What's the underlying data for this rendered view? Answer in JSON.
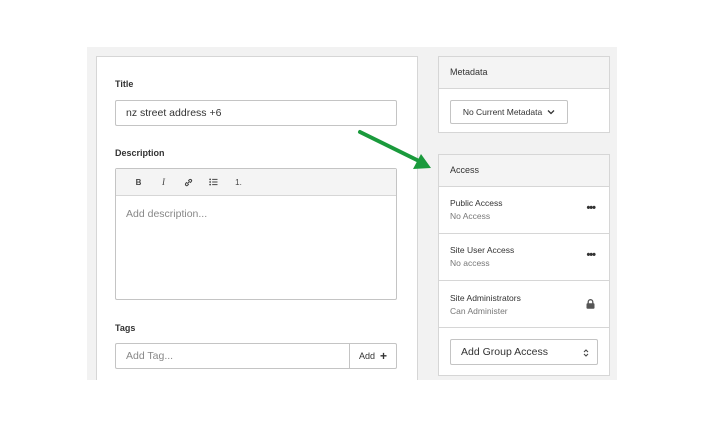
{
  "form": {
    "title_label": "Title",
    "title_value": "nz street address +6",
    "description_label": "Description",
    "toolbar": {
      "bold": "B",
      "italic": "I",
      "link": "🔗",
      "bullets": "☰",
      "numbered": "1."
    },
    "description_placeholder": "Add description...",
    "tags_label": "Tags",
    "tag_placeholder": "Add Tag...",
    "tag_add_label": "Add",
    "tag_add_icon": "+"
  },
  "metadata": {
    "header": "Metadata",
    "button_label": "No Current Metadata",
    "chevron": "⌄"
  },
  "access": {
    "header": "Access",
    "rows": [
      {
        "title": "Public Access",
        "value": "No Access",
        "icon": "more-dots-icon"
      },
      {
        "title": "Site User Access",
        "value": "No access",
        "icon": "more-dots-icon"
      },
      {
        "title": "Site Administrators",
        "value": "Can Administer",
        "icon": "lock-icon"
      }
    ],
    "more_glyph": "•••",
    "group_select_label": "Add Group Access",
    "group_select_arrows": "⇕"
  },
  "colors": {
    "arrow": "#1a9a3c",
    "border": "#d6d6d6",
    "panel_bg": "#f2f2f2"
  }
}
